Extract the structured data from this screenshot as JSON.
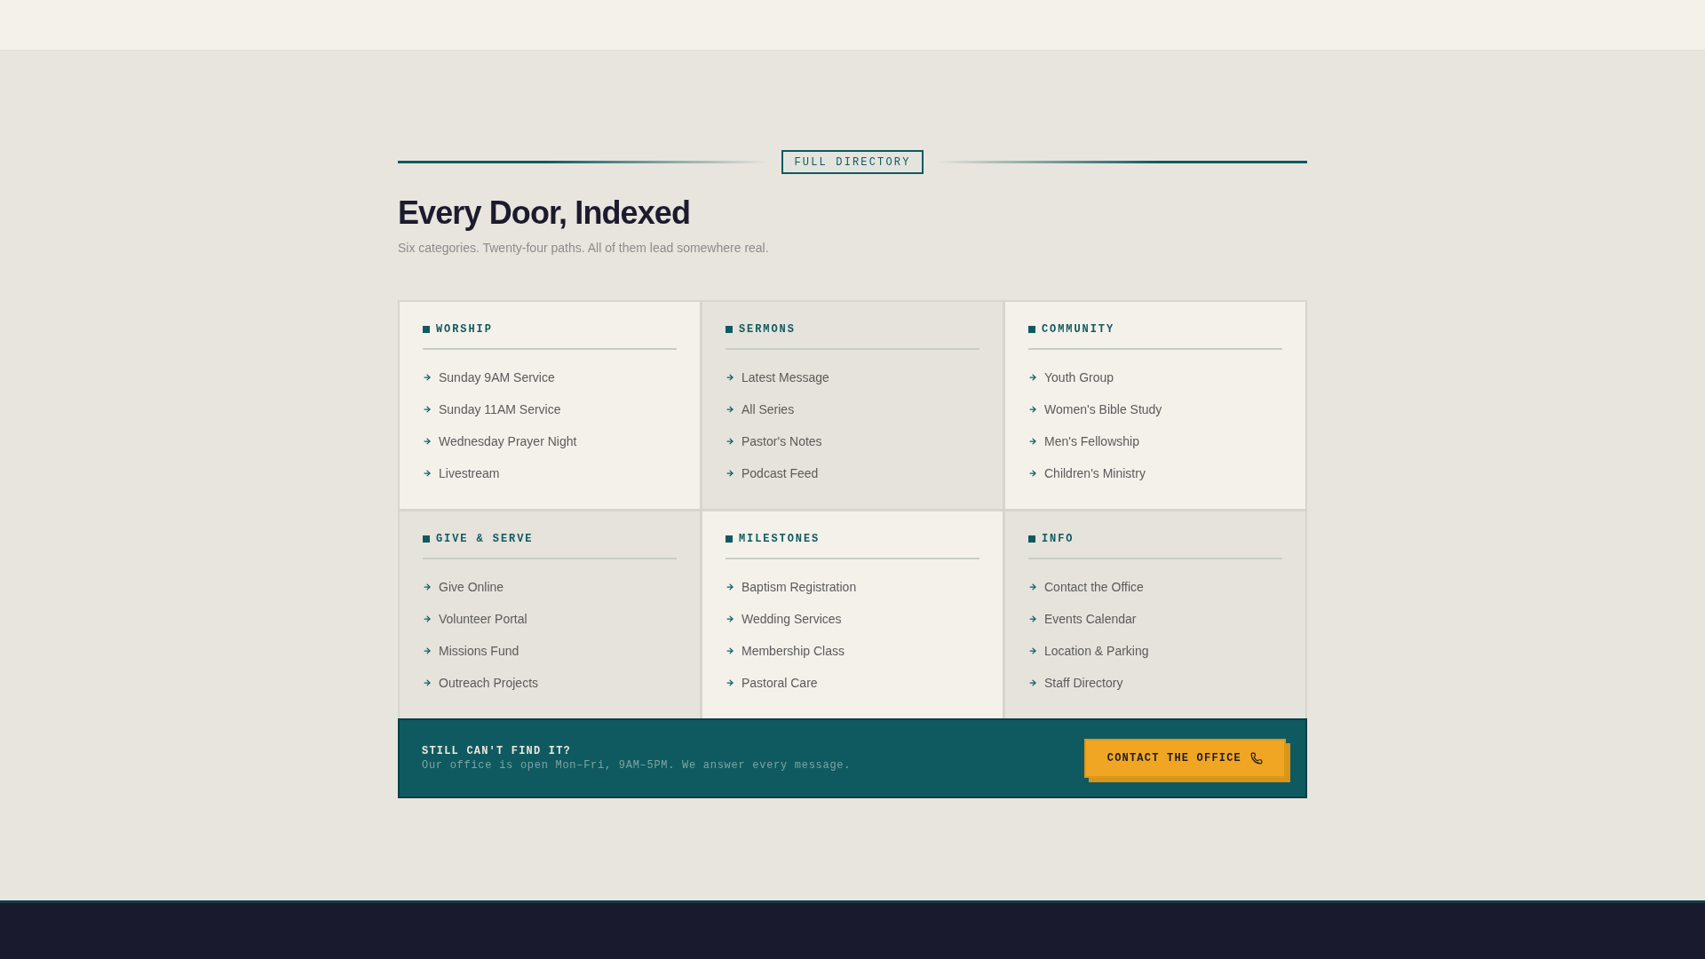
{
  "badge": "FULL DIRECTORY",
  "title": "Every Door, Indexed",
  "subtitle": "Six categories. Twenty-four paths. All of them lead somewhere real.",
  "categories": [
    {
      "name": "WORSHIP",
      "links": [
        "Sunday 9AM Service",
        "Sunday 11AM Service",
        "Wednesday Prayer Night",
        "Livestream"
      ]
    },
    {
      "name": "SERMONS",
      "links": [
        "Latest Message",
        "All Series",
        "Pastor's Notes",
        "Podcast Feed"
      ]
    },
    {
      "name": "COMMUNITY",
      "links": [
        "Youth Group",
        "Women's Bible Study",
        "Men's Fellowship",
        "Children's Ministry"
      ]
    },
    {
      "name": "GIVE & SERVE",
      "links": [
        "Give Online",
        "Volunteer Portal",
        "Missions Fund",
        "Outreach Projects"
      ]
    },
    {
      "name": "MILESTONES",
      "links": [
        "Baptism Registration",
        "Wedding Services",
        "Membership Class",
        "Pastoral Care"
      ]
    },
    {
      "name": "INFO",
      "links": [
        "Contact the Office",
        "Events Calendar",
        "Location & Parking",
        "Staff Directory"
      ]
    }
  ],
  "cta": {
    "title": "STILL CAN'T FIND IT?",
    "text": "Our office is open Mon–Fri, 9AM–5PM. We answer every message.",
    "button": "CONTACT THE OFFICE"
  }
}
